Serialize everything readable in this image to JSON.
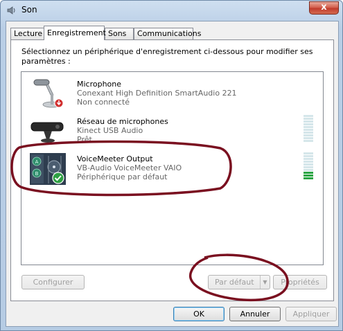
{
  "window": {
    "title": "Son",
    "close_glyph": "x"
  },
  "tabs": [
    {
      "label": "Lecture"
    },
    {
      "label": "Enregistrement"
    },
    {
      "label": "Sons"
    },
    {
      "label": "Communications"
    }
  ],
  "instruction": "Sélectionnez un périphérique d'enregistrement ci-dessous pour modifier ses paramètres :",
  "devices": [
    {
      "name": "Microphone",
      "driver": "Conexant High Definition SmartAudio 221",
      "status": "Non connecté",
      "icon": "microphone-icon",
      "badge": "disconnected-badge-icon"
    },
    {
      "name": "Réseau de microphones",
      "driver": "Kinect USB Audio",
      "status": "Prêt",
      "icon": "kinect-icon",
      "level": 0
    },
    {
      "name": "VoiceMeeter Output",
      "driver": "VB-Audio VoiceMeeter VAIO",
      "status": "Périphérique par défaut",
      "icon": "voicemeeter-icon",
      "badge": "default-check-icon",
      "level": 0.3
    }
  ],
  "panel_buttons": {
    "configure": "Configurer",
    "set_default": "Par défaut",
    "properties": "Propriétés"
  },
  "dialog_buttons": {
    "ok": "OK",
    "cancel": "Annuler",
    "apply": "Appliquer"
  },
  "colors": {
    "annotation": "#7a1020",
    "meter_on": "#2aa545",
    "meter_off": "#d5e6ea"
  }
}
